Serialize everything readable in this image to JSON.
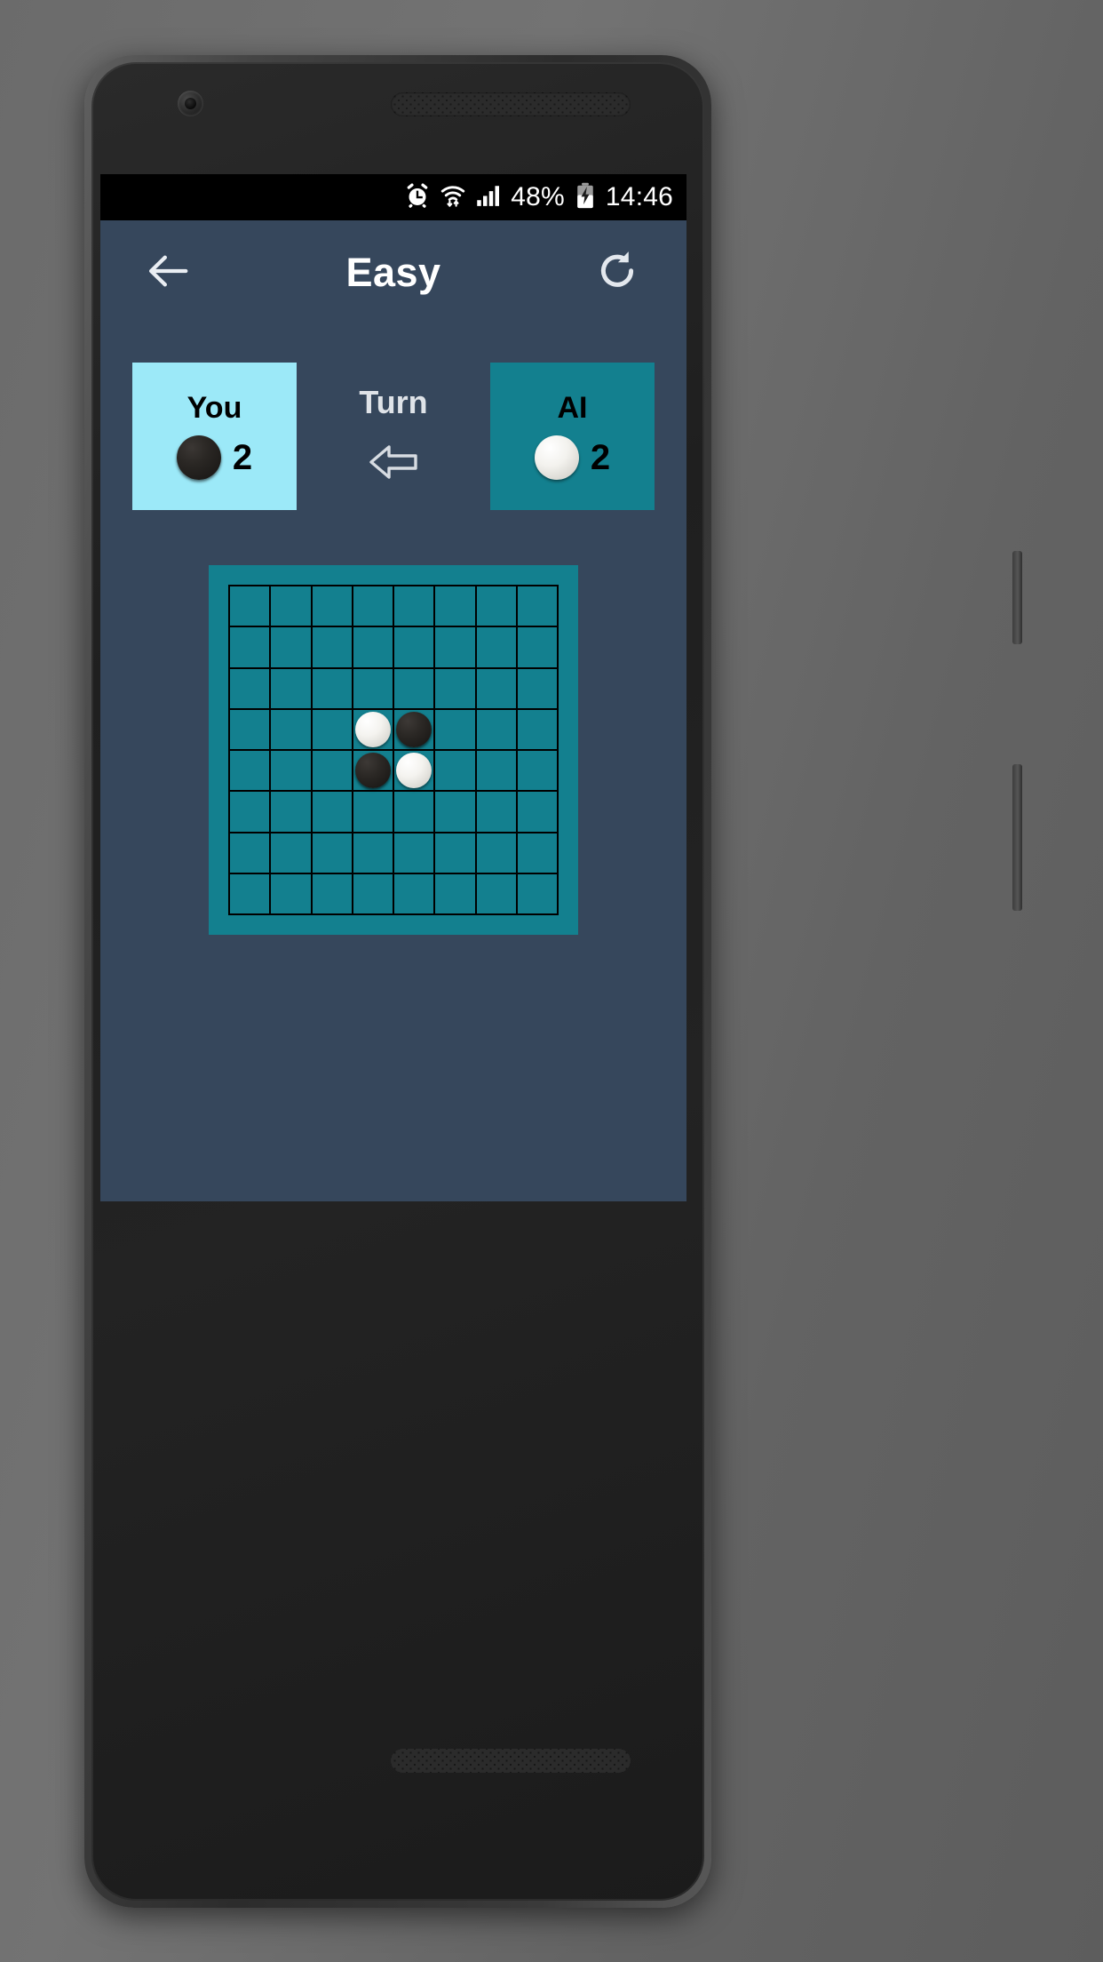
{
  "statusbar": {
    "icons": [
      "alarm-icon",
      "wifi-icon",
      "signal-icon"
    ],
    "battery_percent": "48%",
    "battery_icon": "battery-charging-icon",
    "clock": "14:46"
  },
  "appbar": {
    "back_icon": "back-arrow-icon",
    "title": "Easy",
    "refresh_icon": "refresh-icon"
  },
  "score": {
    "you": {
      "label": "You",
      "disc": "black",
      "count": "2",
      "bg": "#9ce9f8",
      "active": true
    },
    "ai": {
      "label": "AI",
      "disc": "white",
      "count": "2",
      "bg": "#13808f",
      "active": false
    },
    "turn": {
      "label": "Turn",
      "arrow_icon": "arrow-left-icon",
      "direction": "left"
    }
  },
  "board": {
    "size": 8,
    "bg": "#13808f",
    "line_color": "#000000",
    "cells": [
      [
        "",
        "",
        "",
        "",
        "",
        "",
        "",
        ""
      ],
      [
        "",
        "",
        "",
        "",
        "",
        "",
        "",
        ""
      ],
      [
        "",
        "",
        "",
        "",
        "",
        "",
        "",
        ""
      ],
      [
        "",
        "",
        "",
        "white",
        "black",
        "",
        "",
        ""
      ],
      [
        "",
        "",
        "",
        "black",
        "white",
        "",
        "",
        ""
      ],
      [
        "",
        "",
        "",
        "",
        "",
        "",
        "",
        ""
      ],
      [
        "",
        "",
        "",
        "",
        "",
        "",
        "",
        ""
      ],
      [
        "",
        "",
        "",
        "",
        "",
        "",
        "",
        ""
      ]
    ]
  },
  "theme": {
    "app_bg": "#36475c",
    "accent_teal": "#13808f",
    "accent_cyan": "#9ce9f8",
    "status_bg": "#000000"
  }
}
